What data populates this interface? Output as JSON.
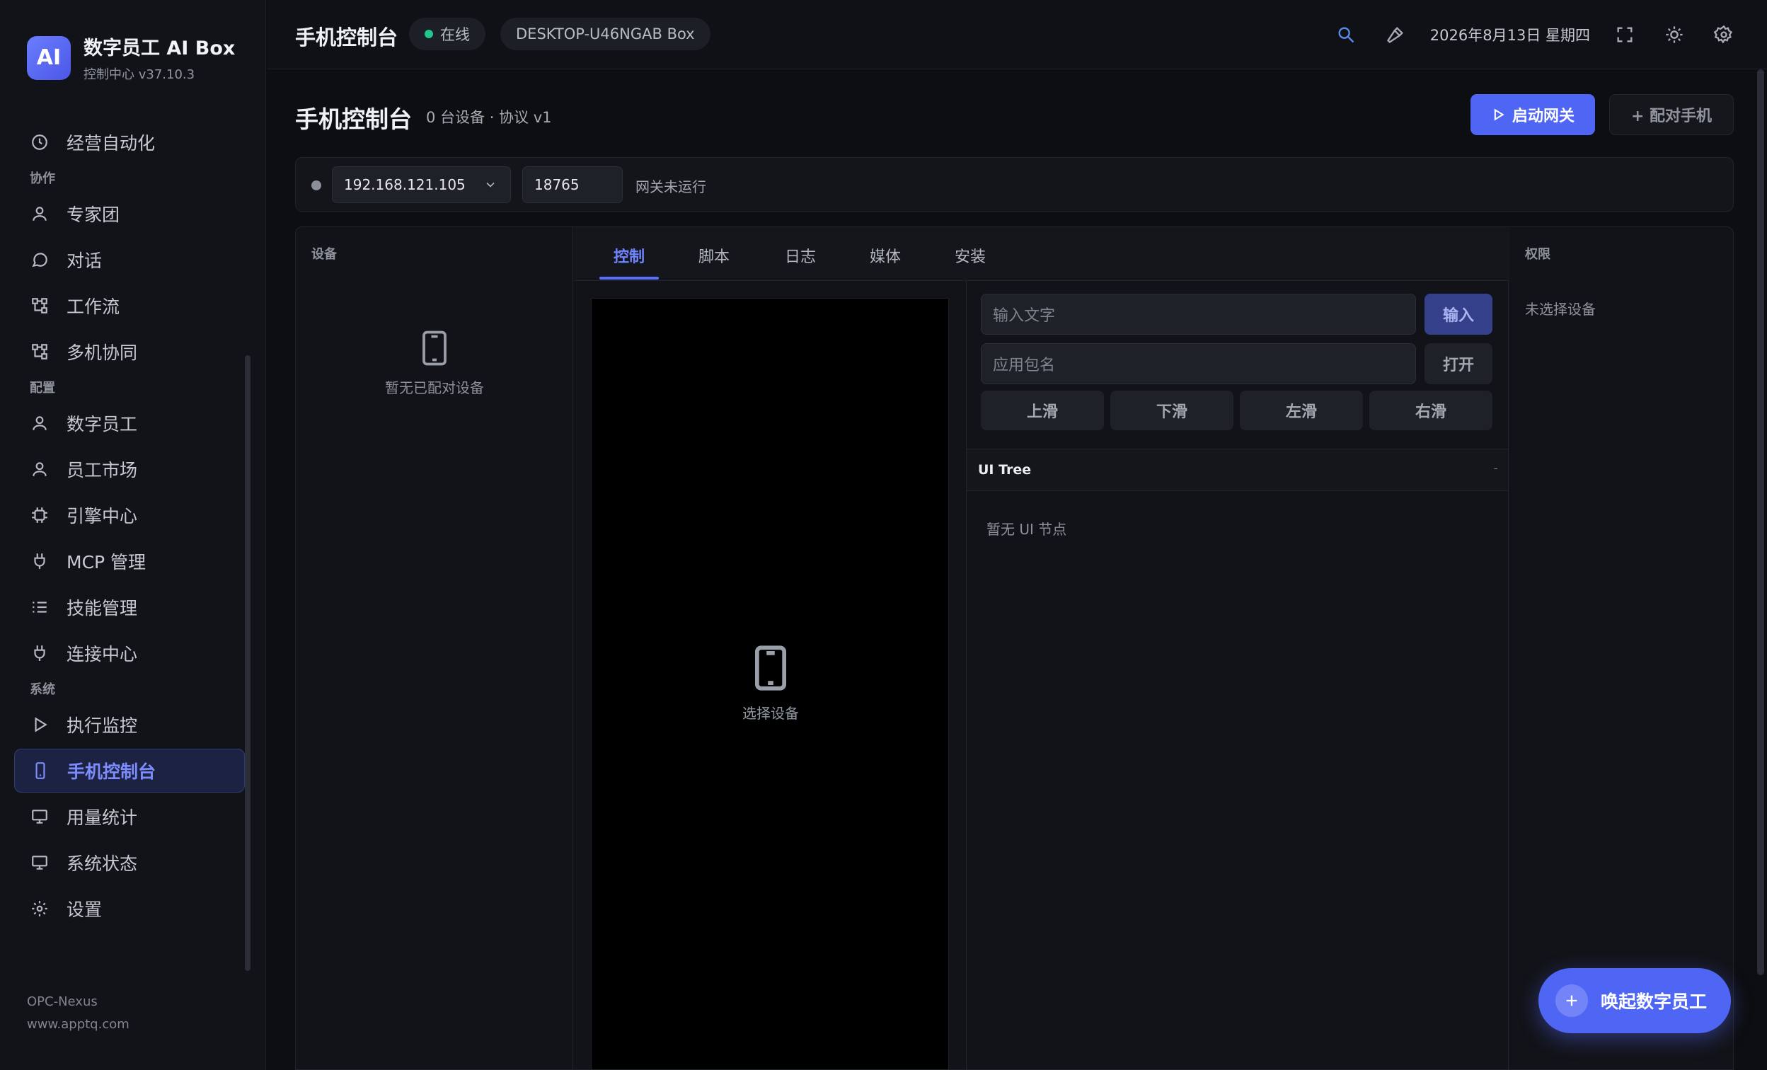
{
  "brand": {
    "logo": "AI",
    "title": "数字员工 AI Box",
    "subtitle": "控制中心 v37.10.3"
  },
  "sidebar": {
    "top_item": "经营自动化",
    "sections": [
      {
        "label": "协作",
        "items": [
          "专家团",
          "对话",
          "工作流",
          "多机协同"
        ]
      },
      {
        "label": "配置",
        "items": [
          "数字员工",
          "员工市场",
          "引擎中心",
          "MCP 管理",
          "技能管理",
          "连接中心"
        ]
      },
      {
        "label": "系统",
        "items": [
          "执行监控",
          "手机控制台",
          "用量统计",
          "系统状态",
          "设置"
        ]
      }
    ],
    "active_item": "手机控制台",
    "footer": {
      "line1": "OPC-Nexus",
      "line2": "www.apptq.com"
    }
  },
  "topbar": {
    "title": "手机控制台",
    "status": "在线",
    "host": "DESKTOP-U46NGAB Box",
    "date": "2026年8月13日 星期四",
    "icons": [
      "search-icon",
      "hammer-icon",
      "fullscreen-icon",
      "sun-icon",
      "gear-icon"
    ]
  },
  "page": {
    "title": "手机控制台",
    "meta": "0 台设备 · 协议 v1",
    "start_gateway": "启动网关",
    "pair_phone": "+ 配对手机"
  },
  "gateway": {
    "ip": "192.168.121.105",
    "port": "18765",
    "status": "网关未运行"
  },
  "devices": {
    "header": "设备",
    "empty": "暂无已配对设备"
  },
  "tabs": [
    "控制",
    "脚本",
    "日志",
    "媒体",
    "安装"
  ],
  "active_tab": "控制",
  "screen": {
    "empty": "选择设备"
  },
  "control": {
    "text_placeholder": "输入文字",
    "input_button": "输入",
    "package_placeholder": "应用包名",
    "open_button": "打开",
    "swipes": [
      "上滑",
      "下滑",
      "左滑",
      "右滑"
    ],
    "tree_title": "UI Tree",
    "tree_dash": "-",
    "tree_empty": "暂无 UI 节点"
  },
  "permissions": {
    "header": "权限",
    "empty": "未选择设备"
  },
  "fab": {
    "label": "唤起数字员工"
  },
  "colors": {
    "accent": "#4f66f5",
    "online": "#22c58b",
    "background": "#0d0e12"
  }
}
